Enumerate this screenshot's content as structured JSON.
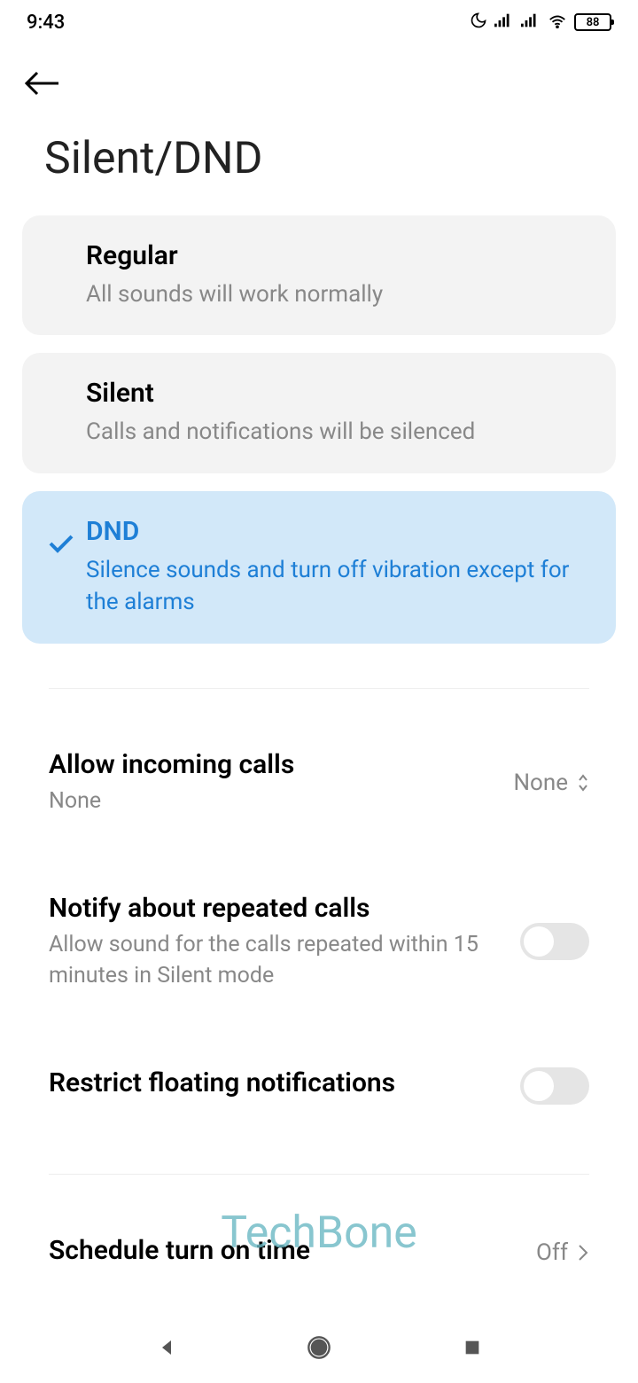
{
  "status": {
    "time": "9:43",
    "battery": "88"
  },
  "title": "Silent/DND",
  "modes": [
    {
      "title": "Regular",
      "desc": "All sounds will work normally",
      "selected": false
    },
    {
      "title": "Silent",
      "desc": "Calls and notifications will be silenced",
      "selected": false
    },
    {
      "title": "DND",
      "desc": "Silence sounds and turn off vibration except for the alarms",
      "selected": true
    }
  ],
  "settings": {
    "allow_calls": {
      "title": "Allow incoming calls",
      "desc": "None",
      "value": "None"
    },
    "repeated_calls": {
      "title": "Notify about repeated calls",
      "desc": "Allow sound for the calls repeated within 15 minutes in Silent mode"
    },
    "restrict_float": {
      "title": "Restrict floating notifications"
    },
    "schedule": {
      "title": "Schedule turn on time",
      "value": "Off"
    }
  },
  "watermark": "TechBone"
}
